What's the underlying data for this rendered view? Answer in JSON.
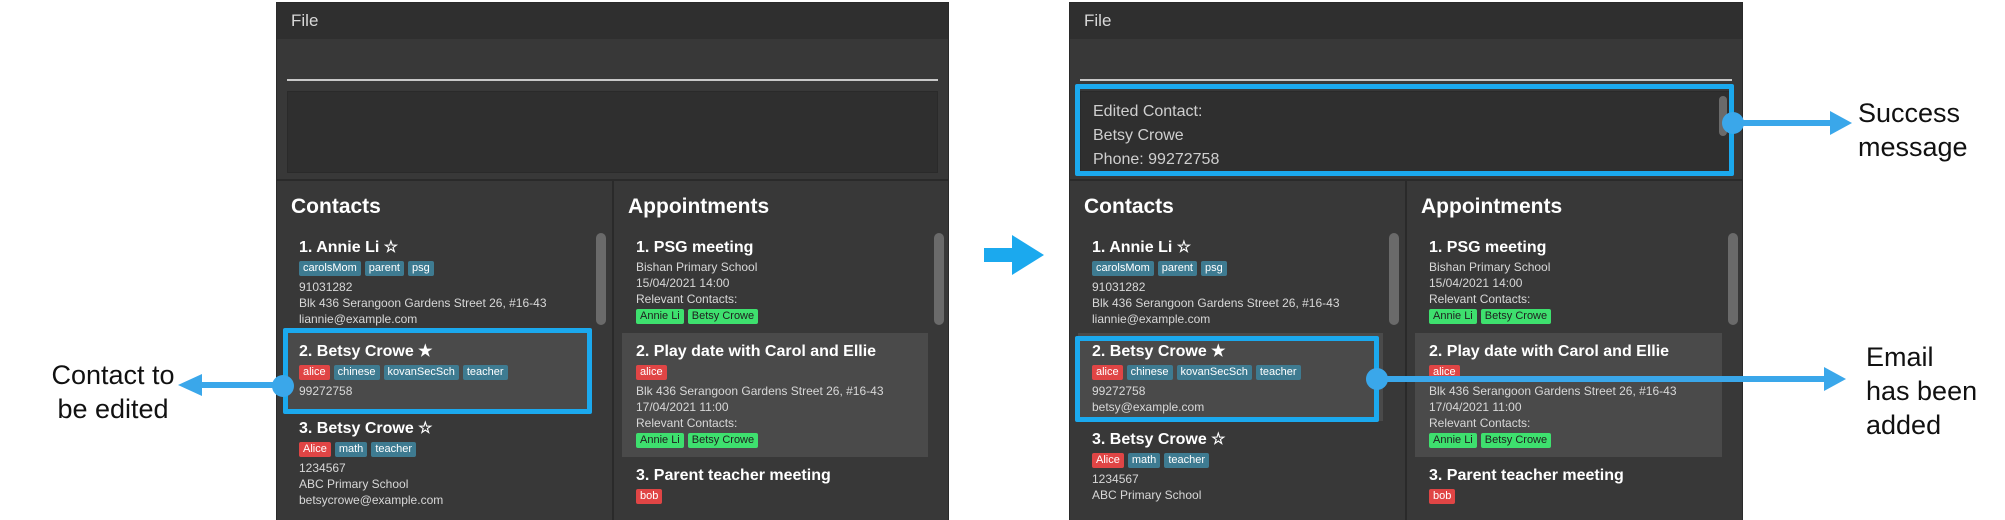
{
  "menu_label": "File",
  "panels": {
    "contacts_title": "Contacts",
    "appointments_title": "Appointments"
  },
  "before": {
    "contacts": [
      {
        "title": "1.  Annie Li ☆",
        "tags": [
          {
            "text": "carolsMom",
            "color": "teal"
          },
          {
            "text": "parent",
            "color": "teal"
          },
          {
            "text": "psg",
            "color": "teal"
          }
        ],
        "lines": [
          "91031282",
          "Blk 436 Serangoon Gardens Street 26, #16-43",
          "liannie@example.com"
        ]
      },
      {
        "title": "2.  Betsy Crowe ★",
        "tags": [
          {
            "text": "alice",
            "color": "red"
          },
          {
            "text": "chinese",
            "color": "teal"
          },
          {
            "text": "kovanSecSch",
            "color": "teal"
          },
          {
            "text": "teacher",
            "color": "teal"
          }
        ],
        "lines": [
          "99272758"
        ]
      },
      {
        "title": "3.  Betsy Crowe ☆",
        "tags": [
          {
            "text": "Alice",
            "color": "red"
          },
          {
            "text": "math",
            "color": "teal"
          },
          {
            "text": "teacher",
            "color": "teal"
          }
        ],
        "lines": [
          "1234567",
          "ABC Primary School",
          "betsycrowe@example.com"
        ]
      }
    ]
  },
  "after": {
    "result_lines": [
      "Edited Contact:",
      "Betsy Crowe",
      "Phone: 99272758"
    ],
    "contacts": [
      {
        "title": "1.  Annie Li ☆",
        "tags": [
          {
            "text": "carolsMom",
            "color": "teal"
          },
          {
            "text": "parent",
            "color": "teal"
          },
          {
            "text": "psg",
            "color": "teal"
          }
        ],
        "lines": [
          "91031282",
          "Blk 436 Serangoon Gardens Street 26, #16-43",
          "liannie@example.com"
        ]
      },
      {
        "title": "2.  Betsy Crowe ★",
        "tags": [
          {
            "text": "alice",
            "color": "red"
          },
          {
            "text": "chinese",
            "color": "teal"
          },
          {
            "text": "kovanSecSch",
            "color": "teal"
          },
          {
            "text": "teacher",
            "color": "teal"
          }
        ],
        "lines": [
          "99272758",
          "betsy@example.com"
        ]
      },
      {
        "title": "3.  Betsy Crowe ☆",
        "tags": [
          {
            "text": "Alice",
            "color": "red"
          },
          {
            "text": "math",
            "color": "teal"
          },
          {
            "text": "teacher",
            "color": "teal"
          }
        ],
        "lines": [
          "1234567",
          "ABC Primary School"
        ]
      }
    ]
  },
  "appointments": [
    {
      "title": "1.  PSG meeting",
      "tags": [],
      "lines": [
        "Bishan Primary School",
        "15/04/2021 14:00",
        "Relevant Contacts:"
      ],
      "contact_tags": [
        "Annie Li",
        "Betsy Crowe"
      ]
    },
    {
      "title": "2.  Play date with Carol and Ellie",
      "tags": [
        {
          "text": "alice",
          "color": "red"
        }
      ],
      "lines": [
        "Blk 436 Serangoon Gardens Street 26, #16-43",
        "17/04/2021 11:00",
        "Relevant Contacts:"
      ],
      "contact_tags": [
        "Annie Li",
        "Betsy Crowe"
      ]
    },
    {
      "title": "3.  Parent teacher meeting",
      "tags": [
        {
          "text": "bob",
          "color": "red"
        }
      ],
      "lines": [],
      "contact_tags": []
    }
  ],
  "annotations": {
    "contact_to_edit": [
      "Contact to",
      "be edited"
    ],
    "success_message": [
      "Success",
      "message"
    ],
    "email_added": [
      "Email",
      "has been",
      "added"
    ]
  },
  "colors": {
    "highlight": "#1ba9ee",
    "arrow": "#3aa7ea",
    "window_bg": "#383838",
    "tag_teal": "#3e7b91",
    "tag_red": "#e04545",
    "tag_green": "#3ee06e"
  }
}
